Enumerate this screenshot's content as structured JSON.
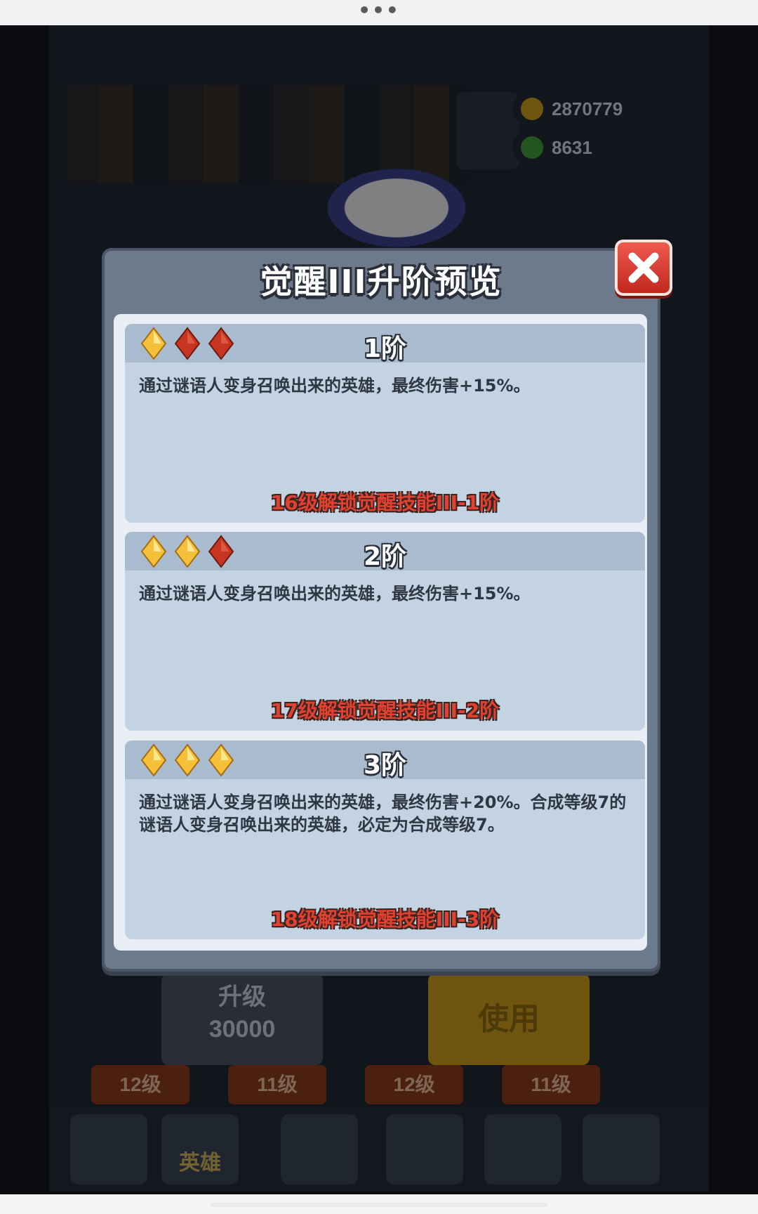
{
  "topbar": {
    "menu": "•••"
  },
  "background": {
    "coins": "2870779",
    "gems": "8631",
    "upgrade_label": "升级",
    "upgrade_cost": "30000",
    "use_label": "使用",
    "levels": [
      "12级",
      "11级",
      "12级",
      "11级"
    ],
    "nav_hero": "英雄"
  },
  "modal": {
    "title": "觉醒III升阶预览",
    "stages": [
      {
        "name": "1阶",
        "gems_filled": 1,
        "gems_total": 3,
        "description": "通过谜语人变身召唤出来的英雄，最终伤害+15%。",
        "unlock": "16级解锁觉醒技能III-1阶"
      },
      {
        "name": "2阶",
        "gems_filled": 2,
        "gems_total": 3,
        "description": "通过谜语人变身召唤出来的英雄，最终伤害+15%。",
        "unlock": "17级解锁觉醒技能III-2阶"
      },
      {
        "name": "3阶",
        "gems_filled": 3,
        "gems_total": 3,
        "description": "通过谜语人变身召唤出来的英雄，最终伤害+20%。合成等级7的谜语人变身召唤出来的英雄，必定为合成等级7。",
        "unlock": "18级解锁觉醒技能III-3阶"
      }
    ]
  },
  "colors": {
    "gem_gold": "#f5c13a",
    "gem_red": "#c7341f",
    "unlock_red": "#e2412f"
  }
}
